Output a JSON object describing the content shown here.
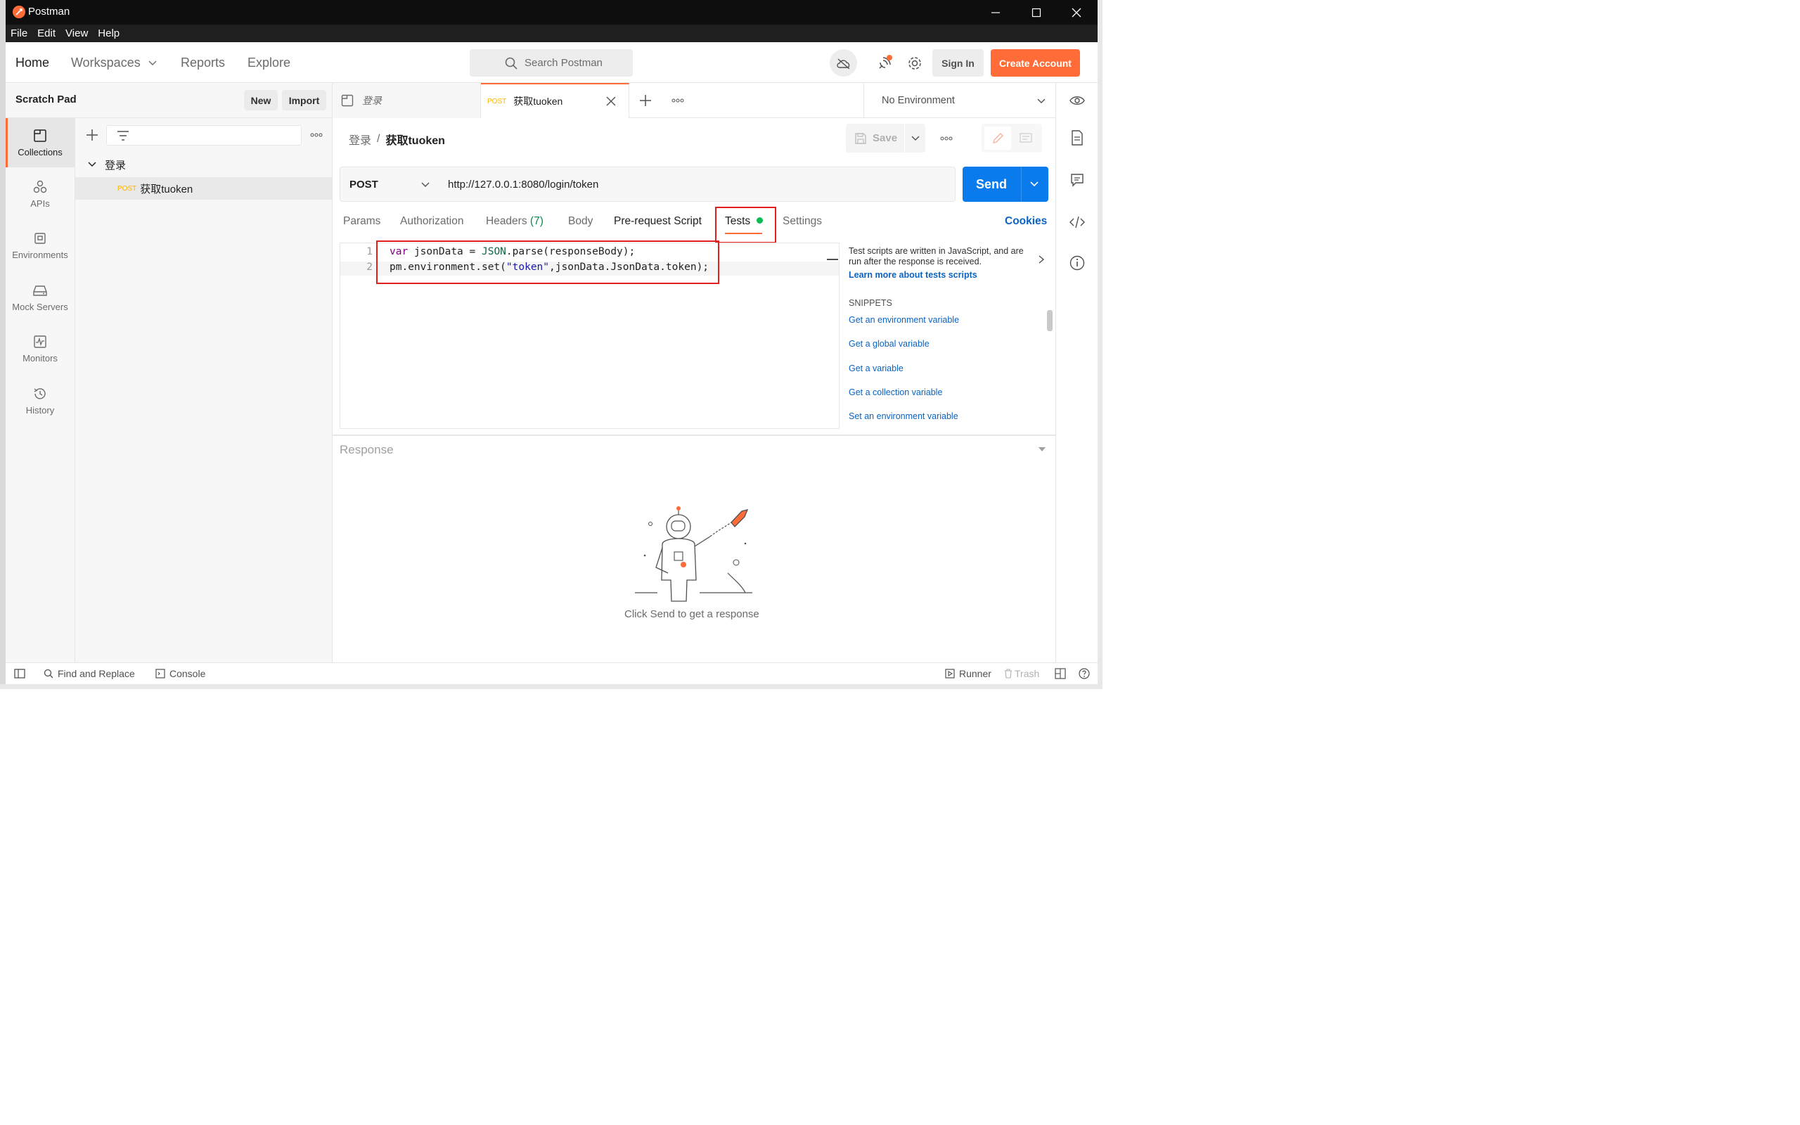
{
  "app": {
    "title": "Postman"
  },
  "menu": [
    "File",
    "Edit",
    "View",
    "Help"
  ],
  "topnav": {
    "home": "Home",
    "workspaces": "Workspaces",
    "reports": "Reports",
    "explore": "Explore",
    "search_placeholder": "Search Postman",
    "sign_in": "Sign In",
    "create_account": "Create Account"
  },
  "scratchpad": {
    "title": "Scratch Pad",
    "new_label": "New",
    "import_label": "Import"
  },
  "rail": [
    {
      "label": "Collections",
      "icon": "collections-icon",
      "active": true
    },
    {
      "label": "APIs",
      "icon": "apis-icon"
    },
    {
      "label": "Environments",
      "icon": "environments-icon"
    },
    {
      "label": "Mock Servers",
      "icon": "mock-servers-icon"
    },
    {
      "label": "Monitors",
      "icon": "monitors-icon"
    },
    {
      "label": "History",
      "icon": "history-icon"
    }
  ],
  "tree": {
    "folder": "登录",
    "request_method": "POST",
    "request_name": "获取tuoken"
  },
  "tabs": [
    {
      "label": "登录"
    },
    {
      "method": "POST",
      "label": "获取tuoken",
      "active": true
    }
  ],
  "environment": {
    "selected": "No Environment"
  },
  "breadcrumb": {
    "parent": "登录",
    "sep": "/",
    "current": "获取tuoken"
  },
  "toolbar": {
    "save_label": "Save"
  },
  "request": {
    "method": "POST",
    "url": "http://127.0.0.1:8080/login/token",
    "send_label": "Send"
  },
  "request_tabs": {
    "params": "Params",
    "authorization": "Authorization",
    "headers": "Headers",
    "headers_count": "(7)",
    "body": "Body",
    "prerequest": "Pre-request Script",
    "tests": "Tests",
    "settings": "Settings",
    "cookies": "Cookies"
  },
  "editor": {
    "lines": [
      {
        "num": "1",
        "text": "var jsonData = JSON.parse(responseBody);"
      },
      {
        "num": "2",
        "text": "pm.environment.set(\"token\",jsonData.JsonData.token);"
      }
    ]
  },
  "snippets": {
    "intro": "Test scripts are written in JavaScript, and are run after the response is received.",
    "learn_more": "Learn more about tests scripts",
    "heading": "SNIPPETS",
    "items": [
      "Get an environment variable",
      "Get a global variable",
      "Get a variable",
      "Get a collection variable",
      "Set an environment variable"
    ]
  },
  "response": {
    "title": "Response",
    "empty_message": "Click Send to get a response"
  },
  "statusbar": {
    "find_replace": "Find and Replace",
    "console": "Console",
    "runner": "Runner",
    "trash": "Trash"
  },
  "colors": {
    "brand": "#ff6c37",
    "send": "#097bed",
    "link": "#0b63c2",
    "highlight": "#e41f1f",
    "tests_dot": "#0cbb52",
    "headers_count": "#0a8a4a"
  }
}
